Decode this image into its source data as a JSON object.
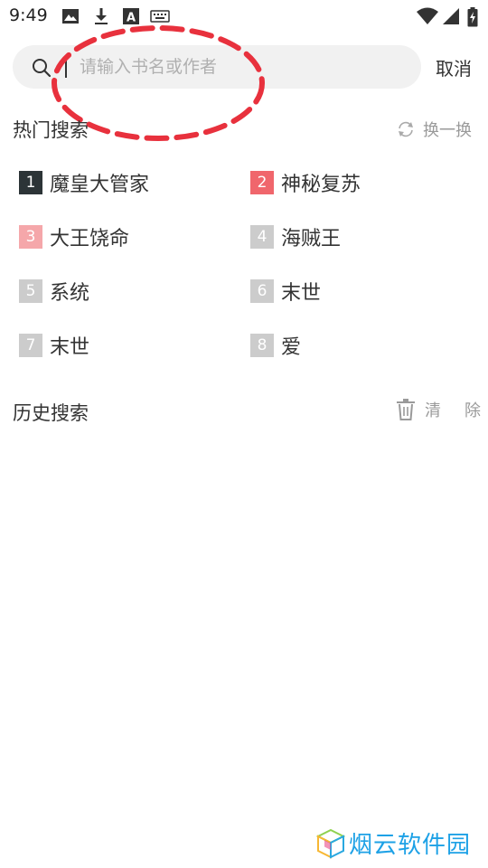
{
  "status_bar": {
    "time": "9:49",
    "icons": [
      "image-icon",
      "download-icon",
      "font-a-icon",
      "keyboard-icon",
      "wifi-icon",
      "signal-icon",
      "battery-charging-icon"
    ]
  },
  "search": {
    "placeholder": "请输入书名或作者",
    "value": "",
    "cancel_label": "取消",
    "annotation_color": "#e8313d"
  },
  "hot_search": {
    "title": "热门搜索",
    "refresh_label": "换一换",
    "items": [
      {
        "rank": "1",
        "title": "魔皇大管家",
        "rank_color": "#2c3437"
      },
      {
        "rank": "2",
        "title": "神秘复苏",
        "rank_color": "#f0666c"
      },
      {
        "rank": "3",
        "title": "大王饶命",
        "rank_color": "#f5a7aa"
      },
      {
        "rank": "4",
        "title": "海贼王",
        "rank_color": "#cccccc"
      },
      {
        "rank": "5",
        "title": "系统",
        "rank_color": "#cccccc"
      },
      {
        "rank": "6",
        "title": "末世",
        "rank_color": "#cccccc"
      },
      {
        "rank": "7",
        "title": "末世",
        "rank_color": "#cccccc"
      },
      {
        "rank": "8",
        "title": "爱",
        "rank_color": "#cccccc"
      }
    ]
  },
  "history": {
    "title": "历史搜索",
    "clear_label": "清　除"
  },
  "watermark": {
    "text": "烟云软件园",
    "color": "#1da1e6"
  }
}
